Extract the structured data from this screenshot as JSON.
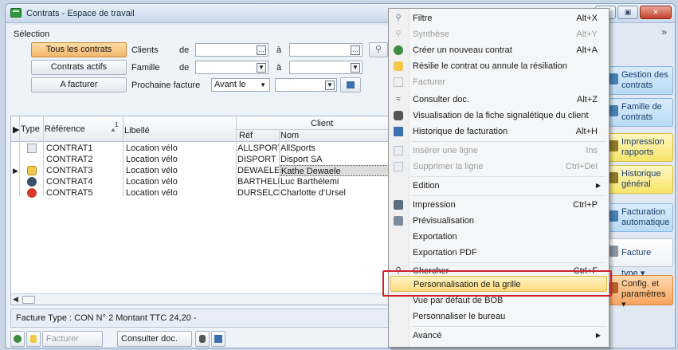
{
  "window": {
    "title": "Contrats - Espace de travail",
    "buttons": [
      "▭",
      "▣",
      "✕"
    ]
  },
  "selection": {
    "label": "Sélection",
    "buttons": [
      "Tous les contrats",
      "Contrats actifs",
      "A facturer"
    ],
    "clients_label": "Clients",
    "de1": "de",
    "famille_label": "Famille",
    "de2": "de",
    "prochaine_label": "Prochaine facture",
    "a1": "à",
    "a2": "à",
    "avant_le": "Avant le"
  },
  "grid": {
    "col_type": "Type",
    "col_reference": "Référence",
    "sort_num": "1",
    "col_libelle": "Libellé",
    "col_client": "Client",
    "col_ref": "Réf",
    "col_nom": "Nom",
    "rows": [
      {
        "reference": "CONTRAT1",
        "libelle": "Location vélo",
        "ref": "ALLSPORTS",
        "nom": "AllSports"
      },
      {
        "reference": "CONTRAT2",
        "libelle": "Location vélo",
        "ref": "DISPORT",
        "nom": "Disport SA"
      },
      {
        "reference": "CONTRAT3",
        "libelle": "Location vélo",
        "ref": "DEWAELEK",
        "nom": "Kathe Dewaele"
      },
      {
        "reference": "CONTRAT4",
        "libelle": "Location vélo",
        "ref": "BARTHELEM",
        "nom": "Luc Barthélemi"
      },
      {
        "reference": "CONTRAT5",
        "libelle": "Location vélo",
        "ref": "DURSELC",
        "nom": "Charlotte d’Ursel"
      }
    ]
  },
  "status": "Facture Type :  CON N° 2 Montant TTC 24,20 -",
  "bottombar": {
    "facturer": "Facturer",
    "consulter": "Consulter doc."
  },
  "rightpanel": {
    "collapse": "»",
    "items": [
      "Gestion des contrats",
      "Famille de contrats",
      "Impression rapports",
      "Historique général",
      "Facturation automatique",
      "Facture type",
      "Config. et paramètres"
    ]
  },
  "menu": {
    "items": [
      {
        "label": "Filtre",
        "shortcut": "Alt+X",
        "disabled": false
      },
      {
        "label": "Synthèse",
        "shortcut": "Alt+Y",
        "disabled": true
      },
      {
        "label": "Créer un nouveau contrat",
        "shortcut": "Alt+A",
        "disabled": false
      },
      {
        "label": "Résilie le contrat ou annule la résiliation",
        "shortcut": "",
        "disabled": false
      },
      {
        "label": "Facturer",
        "shortcut": "",
        "disabled": true
      },
      {
        "label": "Consulter doc.",
        "shortcut": "Alt+Z",
        "disabled": false
      },
      {
        "label": "Visualisation de la fiche signalétique du client",
        "shortcut": "",
        "disabled": false
      },
      {
        "label": "Historique de facturation",
        "shortcut": "Alt+H",
        "disabled": false
      },
      {
        "label": "Insérer une ligne",
        "shortcut": "Ins",
        "disabled": true
      },
      {
        "label": "Supprimer la ligne",
        "shortcut": "Ctrl+Del",
        "disabled": true
      },
      {
        "label": "Edition",
        "shortcut": "",
        "disabled": false
      },
      {
        "label": "Impression",
        "shortcut": "Ctrl+P",
        "disabled": false
      },
      {
        "label": "Prévisualisation",
        "shortcut": "",
        "disabled": false
      },
      {
        "label": "Exportation",
        "shortcut": "",
        "disabled": false
      },
      {
        "label": "Exportation PDF",
        "shortcut": "",
        "disabled": false
      },
      {
        "label": "Chercher",
        "shortcut": "Ctrl+F",
        "disabled": false
      },
      {
        "label": "Personnalisation de la grille",
        "shortcut": "",
        "disabled": false
      },
      {
        "label": "Vue par défaut de BOB",
        "shortcut": "",
        "disabled": false
      },
      {
        "label": "Personnaliser le bureau",
        "shortcut": "",
        "disabled": false
      },
      {
        "label": "Avancé",
        "shortcut": "",
        "disabled": false
      }
    ]
  },
  "colors": {
    "accent": "#f3b66a",
    "highlight_frame": "#d0202a",
    "menu_highlight": "#fddc7e"
  }
}
